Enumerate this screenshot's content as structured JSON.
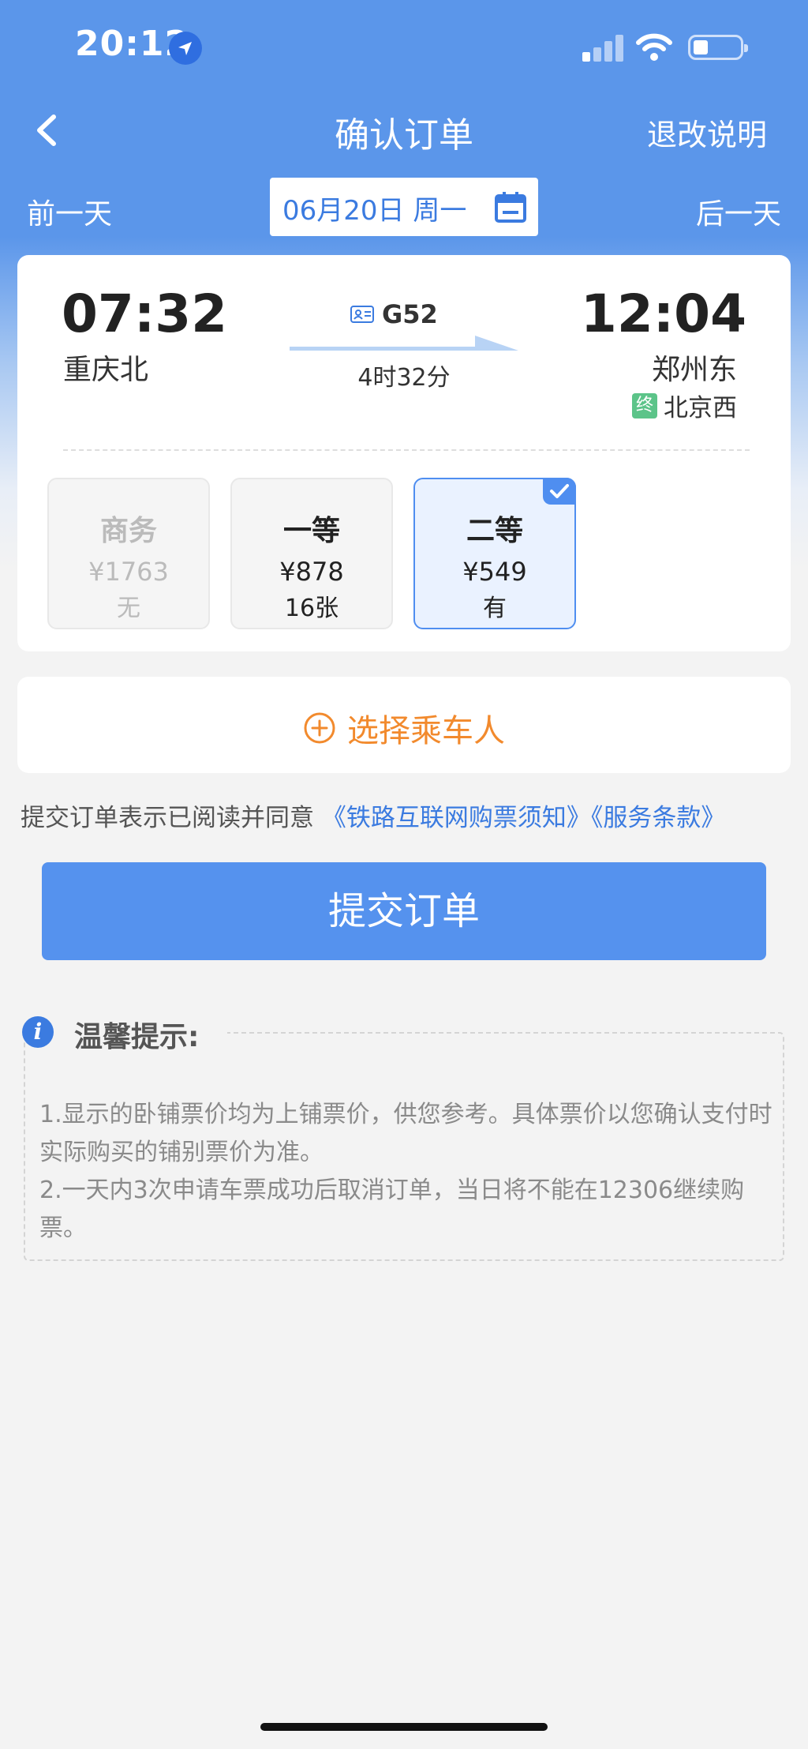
{
  "status_bar": {
    "time": "20:12"
  },
  "nav": {
    "title": "确认订单",
    "right_link": "退改说明"
  },
  "date_bar": {
    "prev": "前一天",
    "date": "06月20日 周一",
    "next": "后一天"
  },
  "train": {
    "number": "G52",
    "departure": {
      "time": "07:32",
      "station": "重庆北"
    },
    "arrival": {
      "time": "12:04",
      "station": "郑州东"
    },
    "duration": "4时32分",
    "terminal_badge": "终",
    "terminal": "北京西"
  },
  "seats": [
    {
      "name": "商务",
      "price": "¥1763",
      "availability": "无",
      "state": "disabled"
    },
    {
      "name": "一等",
      "price": "¥878",
      "availability": "16张",
      "state": "normal"
    },
    {
      "name": "二等",
      "price": "¥549",
      "availability": "有",
      "state": "selected"
    }
  ],
  "passenger": {
    "label": "选择乘车人"
  },
  "agreement": {
    "text": "提交订单表示已阅读并同意",
    "link1": "《铁路互联网购票须知》",
    "link2": "《服务条款》"
  },
  "submit_label": "提交订单",
  "tips": {
    "title": "温馨提示:",
    "lines": [
      "1.显示的卧铺票价均为上铺票价，供您参考。具体票价以您确认支付时实际购买的铺别票价为准。",
      "2.一天内3次申请车票成功后取消订单，当日将不能在12306继续购票。"
    ]
  },
  "colors": {
    "primary": "#5592ee",
    "accent": "#f28a2d",
    "link": "#3b7be0"
  }
}
